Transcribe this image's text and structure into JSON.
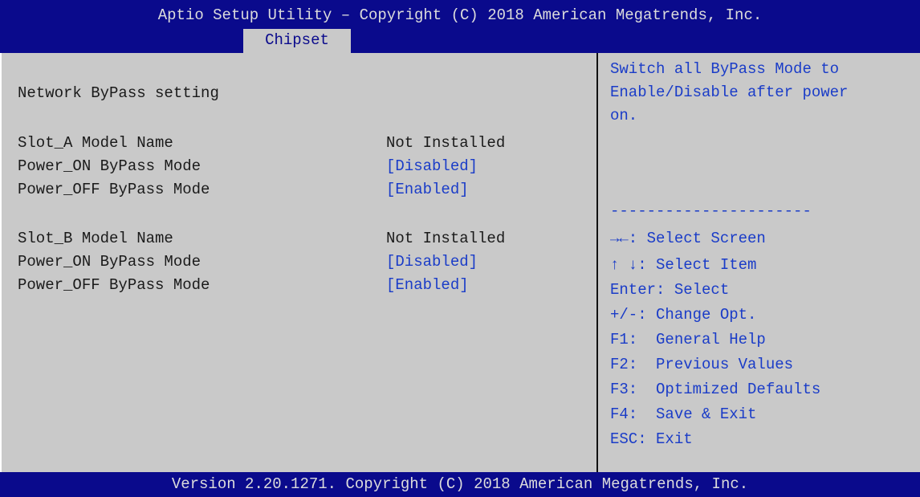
{
  "header": {
    "title": "Aptio Setup Utility – Copyright (C) 2018 American Megatrends, Inc.",
    "active_tab": "Chipset"
  },
  "main": {
    "section_title": "Network ByPass setting",
    "slot_a": {
      "model_label": "Slot_A Model Name",
      "model_value": "Not Installed",
      "power_on_label": "Power_ON ByPass Mode",
      "power_on_value": "[Disabled]",
      "power_off_label": "Power_OFF ByPass Mode",
      "power_off_value": "[Enabled]"
    },
    "slot_b": {
      "model_label": "Slot_B Model Name",
      "model_value": "Not Installed",
      "power_on_label": "Power_ON ByPass Mode",
      "power_on_value": "[Disabled]",
      "power_off_label": "Power_OFF ByPass Mode",
      "power_off_value": "[Enabled]"
    }
  },
  "help": {
    "description": [
      "Switch all ByPass Mode to",
      "Enable/Disable after power",
      "on."
    ],
    "separator": "----------------------",
    "keys": [
      "→←: Select Screen",
      "↑ ↓: Select Item",
      "Enter: Select",
      "+/-: Change Opt.",
      "F1:  General Help",
      "F2:  Previous Values",
      "F3:  Optimized Defaults",
      "F4:  Save & Exit",
      "ESC: Exit"
    ]
  },
  "footer": {
    "version": "Version 2.20.1271. Copyright (C) 2018 American Megatrends, Inc."
  },
  "colors": {
    "header_bg": "#0a0a8c",
    "body_bg": "#c9c9c9",
    "option_text": "#1a3cc8",
    "static_text": "#1a1a1a"
  }
}
